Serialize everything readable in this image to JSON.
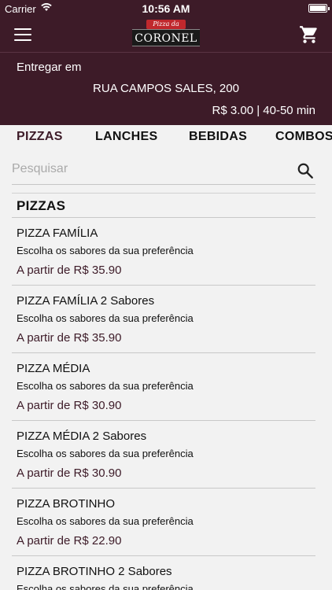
{
  "status_bar": {
    "carrier": "Carrier",
    "time": "10:56 AM"
  },
  "navbar": {
    "menu_icon": "hamburger-menu-icon",
    "cart_icon": "shopping-cart-icon",
    "logo_small": "Pizza da",
    "logo_big": "CORONEL"
  },
  "delivery": {
    "label": "Entregar em",
    "address": "RUA CAMPOS SALES, 200",
    "fee_time": "R$ 3.00 | 40-50 min"
  },
  "tabs": [
    {
      "label": "PIZZAS"
    },
    {
      "label": "LANCHES"
    },
    {
      "label": "BEBIDAS"
    },
    {
      "label": "COMBOS"
    }
  ],
  "search": {
    "placeholder": "Pesquisar",
    "value": ""
  },
  "section": {
    "title": "PIZZAS"
  },
  "items": [
    {
      "name": "PIZZA FAMÍLIA",
      "desc": "Escolha os sabores da sua preferência",
      "price": "A partir de R$ 35.90"
    },
    {
      "name": "PIZZA FAMÍLIA 2 Sabores",
      "desc": "Escolha os sabores da sua preferência",
      "price": "A partir de R$ 35.90"
    },
    {
      "name": "PIZZA MÉDIA",
      "desc": "Escolha os sabores da sua preferência",
      "price": "A partir de R$ 30.90"
    },
    {
      "name": "PIZZA MÉDIA 2 Sabores",
      "desc": "Escolha os sabores da sua preferência",
      "price": "A partir de R$ 30.90"
    },
    {
      "name": "PIZZA BROTINHO",
      "desc": "Escolha os sabores da sua preferência",
      "price": "A partir de R$ 22.90"
    },
    {
      "name": "PIZZA BROTINHO 2 Sabores",
      "desc": "Escolha os sabores da sua preferência",
      "price": ""
    }
  ],
  "colors": {
    "brand": "#3d1b28",
    "background": "#f2f2f2"
  }
}
